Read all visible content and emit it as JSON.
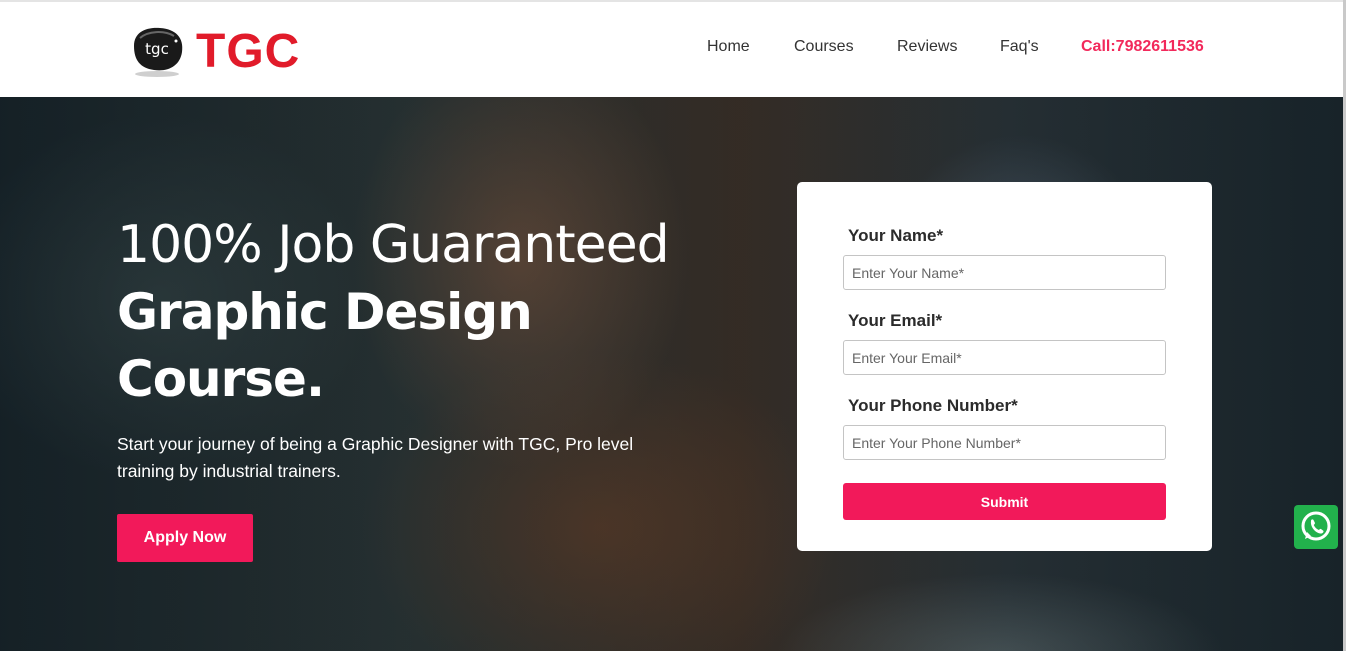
{
  "brand": {
    "logo_badge": "tgc",
    "logo_text": "TGC",
    "color": "#e11b2a"
  },
  "nav": {
    "items": [
      {
        "label": "Home"
      },
      {
        "label": "Courses"
      },
      {
        "label": "Reviews"
      },
      {
        "label": "Faq's"
      }
    ],
    "call": "Call:7982611536",
    "call_color": "#f2295b"
  },
  "hero": {
    "line1": "100% Job Guaranteed",
    "line2": "Graphic Design",
    "line3": "Course.",
    "subtitle": "Start your journey of being a Graphic Designer with TGC, Pro level training by industrial trainers.",
    "apply_label": "Apply Now"
  },
  "form": {
    "name_label": "Your Name*",
    "name_placeholder": "Enter Your Name*",
    "email_label": "Your Email*",
    "email_placeholder": "Enter Your Email*",
    "phone_label": "Your Phone Number*",
    "phone_placeholder": "Enter Your Phone Number*",
    "submit_label": "Submit"
  },
  "colors": {
    "accent": "#f2195a",
    "whatsapp": "#22b14c"
  },
  "icons": {
    "whatsapp": "whatsapp-icon",
    "logo_badge": "tgc-badge-icon"
  }
}
